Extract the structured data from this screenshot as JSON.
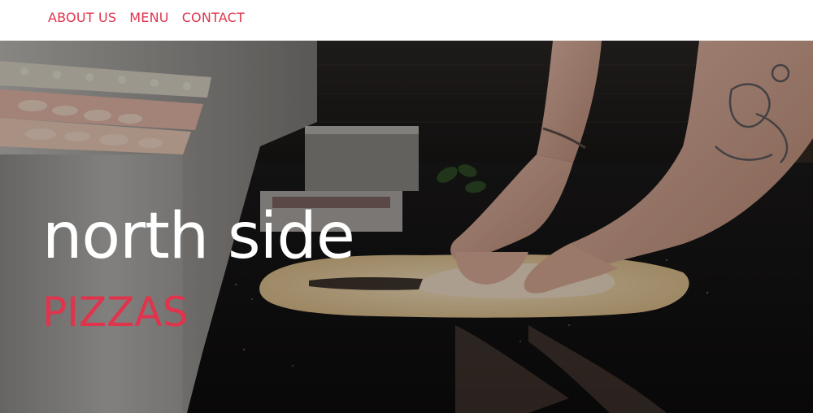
{
  "nav": {
    "items": [
      {
        "label": "ABOUT US"
      },
      {
        "label": "MENU"
      },
      {
        "label": "CONTACT"
      }
    ]
  },
  "hero": {
    "title": "north side",
    "subtitle": "PIZZAS",
    "image": "chef-stretching-pizza-dough-photo"
  },
  "colors": {
    "accent": "#e0344d",
    "nav_background": "#ffffff",
    "title_text": "#ffffff"
  }
}
